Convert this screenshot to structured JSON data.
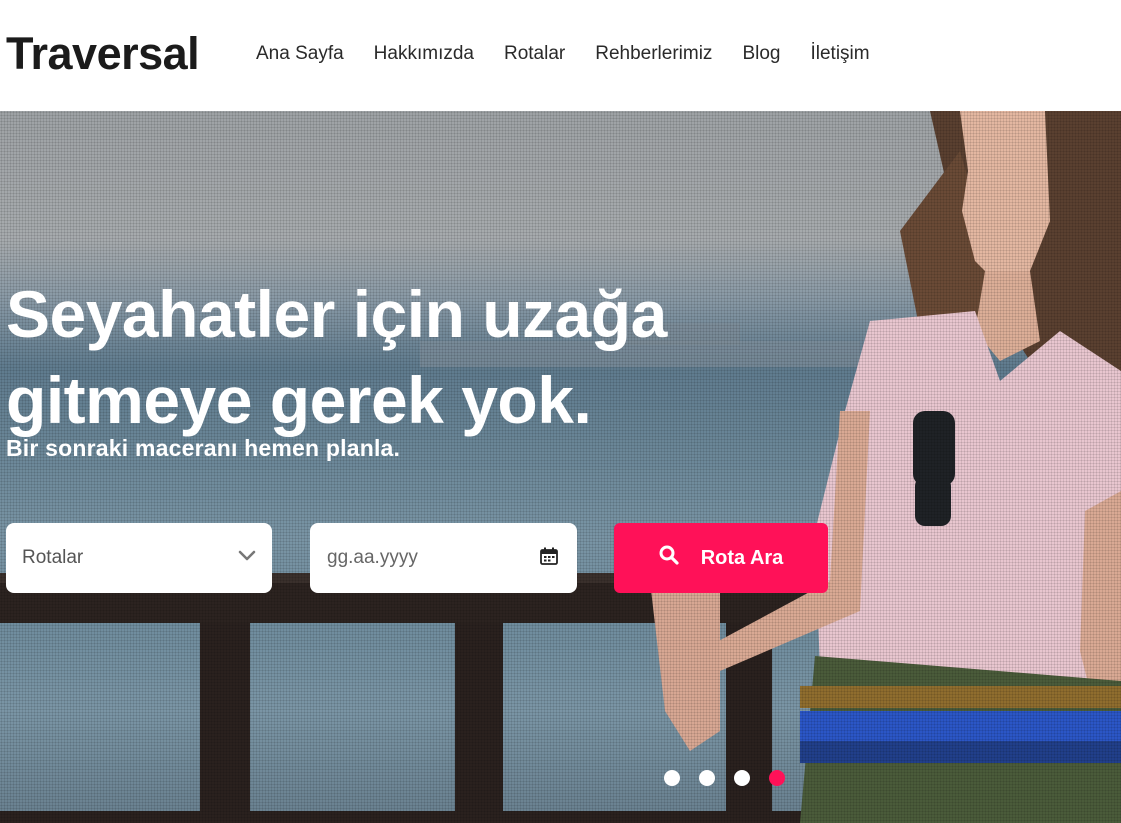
{
  "brand": {
    "logo_text": "Traversal"
  },
  "nav": {
    "items": [
      {
        "label": "Ana Sayfa"
      },
      {
        "label": "Hakkımızda"
      },
      {
        "label": "Rotalar"
      },
      {
        "label": "Rehberlerimiz"
      },
      {
        "label": "Blog"
      },
      {
        "label": "İletişim"
      }
    ]
  },
  "hero": {
    "headline_line1": "Seyahatler için uzağa",
    "headline_line2": "gitmeye gerek yok.",
    "subheadline": "Bir sonraki maceranı hemen planla."
  },
  "search": {
    "route_select": {
      "selected": "Rotalar",
      "icon": "chevron-down-icon"
    },
    "date_input": {
      "placeholder": "gg.aa.yyyy",
      "icon": "calendar-icon"
    },
    "submit": {
      "label": "Rota Ara",
      "icon": "search-icon"
    }
  },
  "carousel": {
    "slide_count": 4,
    "active_index": 4
  },
  "colors": {
    "accent": "#ff1158",
    "text_dark": "#1b1b1b",
    "white": "#ffffff"
  }
}
